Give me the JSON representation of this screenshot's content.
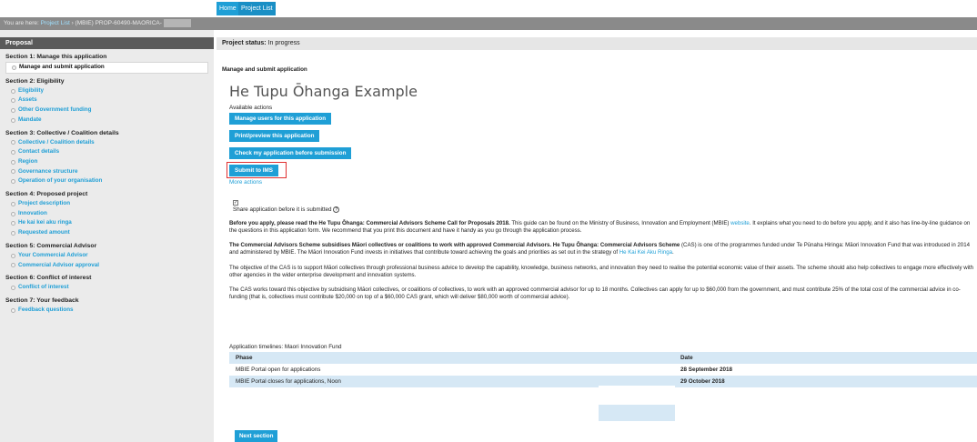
{
  "tabs": {
    "home": "Home",
    "project_list": "Project List"
  },
  "breadcrumb": {
    "prefix": "You are here: ",
    "link": "Project List",
    "rest": " › (MBIE) PROP-60490-MAORICA-"
  },
  "sidebar": {
    "header": "Proposal",
    "sections": [
      {
        "title": "Section 1: Manage this application",
        "items": [
          "Manage and submit application"
        ]
      },
      {
        "title": "Section 2: Eligibility",
        "items": [
          "Eligibility",
          "Assets",
          "Other Government funding",
          "Mandate"
        ]
      },
      {
        "title": "Section 3: Collective / Coalition details",
        "items": [
          "Collective / Coalition details",
          "Contact details",
          "Region",
          "Governance structure",
          "Operation of your organisation"
        ]
      },
      {
        "title": "Section 4: Proposed project",
        "items": [
          "Project description",
          "Innovation",
          "He kai kei aku ringa",
          "Requested amount"
        ]
      },
      {
        "title": "Section 5: Commercial Advisor",
        "items": [
          "Your Commercial Advisor",
          "Commercial Advisor approval"
        ]
      },
      {
        "title": "Section 6: Conflict of interest",
        "items": [
          "Conflict of interest"
        ]
      },
      {
        "title": "Section 7: Your feedback",
        "items": [
          "Feedback questions"
        ]
      }
    ]
  },
  "status": {
    "label": "Project status:",
    "value": " In progress"
  },
  "main": {
    "manage_title": "Manage and submit application",
    "page_title": "He Tupu Ōhanga Example",
    "available_actions": "Available actions",
    "btn_manage_users": "Manage users for this application",
    "btn_print": "Print/preview this application",
    "btn_check": "Check my application before submission",
    "btn_submit": "Submit to IMS",
    "more_actions": "More actions",
    "share_label": "Share application before it is submitted",
    "share_help": "?",
    "checkbox_mark": "✓",
    "p1_bold": "Before you apply, please read the He Tupu Ōhanga: Commercial Advisors Scheme Call for Proposals 2018.",
    "p1_a": "  This guide can be found on the Ministry of Business, Innovation and Employment (MBIE) ",
    "p1_link": "website",
    "p1_b": ".  It explains what you need to do before you apply, and it also has line-by-line guidance on the questions in this application form. We recommend that you print this document and have it handy as you go through the application process.",
    "p2_bold": "The Commercial Advisors Scheme subsidises Māori collectives or coalitions to work with approved Commercial Advisors. He Tupu Ōhanga: Commercial Advisors Scheme",
    "p2_a": " (CAS) is one of the programmes funded under Te Pūnaha Hiringa: Māori Innovation Fund that was introduced in 2014 and administered by MBIE. The Māori Innovation Fund invests in initiatives that contribute toward achieving the goals and priorities as set out in the strategy of ",
    "p2_link": "He Kai Kei Aku Ringa",
    "p2_b": ".",
    "p3": "The objective of the CAS is to support Māori collectives through professional business advice to develop the capability, knowledge, business networks, and innovation they need to realise the potential economic value of their assets. The scheme should also help collectives to engage more effectively with other agencies in the wider enterprise development and innovation systems.",
    "p4": "The CAS works toward this objective by subsidising Māori collectives, or coalitions of collectives, to work with an approved commercial advisor for up to 18 months.  Collectives can apply for up to $60,000 from the government, and must contribute 25% of the total cost of the commercial advice in co-funding (that is, collectives must contribute $20,000 on top of a $60,000 CAS grant, which will deliver $80,000 worth of commercial advice).",
    "timeline_label": "Application timelines: Maori Innovation Fund",
    "table": {
      "headers": [
        "Phase",
        "Date"
      ],
      "rows": [
        [
          "MBIE Portal open for applications",
          "28 September 2018"
        ],
        [
          "MBIE Portal closes for applications, Noon",
          "29 October 2018"
        ]
      ]
    },
    "next_section": "Next section"
  },
  "colors": {
    "accent": "#1f9fd6",
    "highlight_border": "#e03030",
    "table_blue": "#d6e8f5"
  }
}
